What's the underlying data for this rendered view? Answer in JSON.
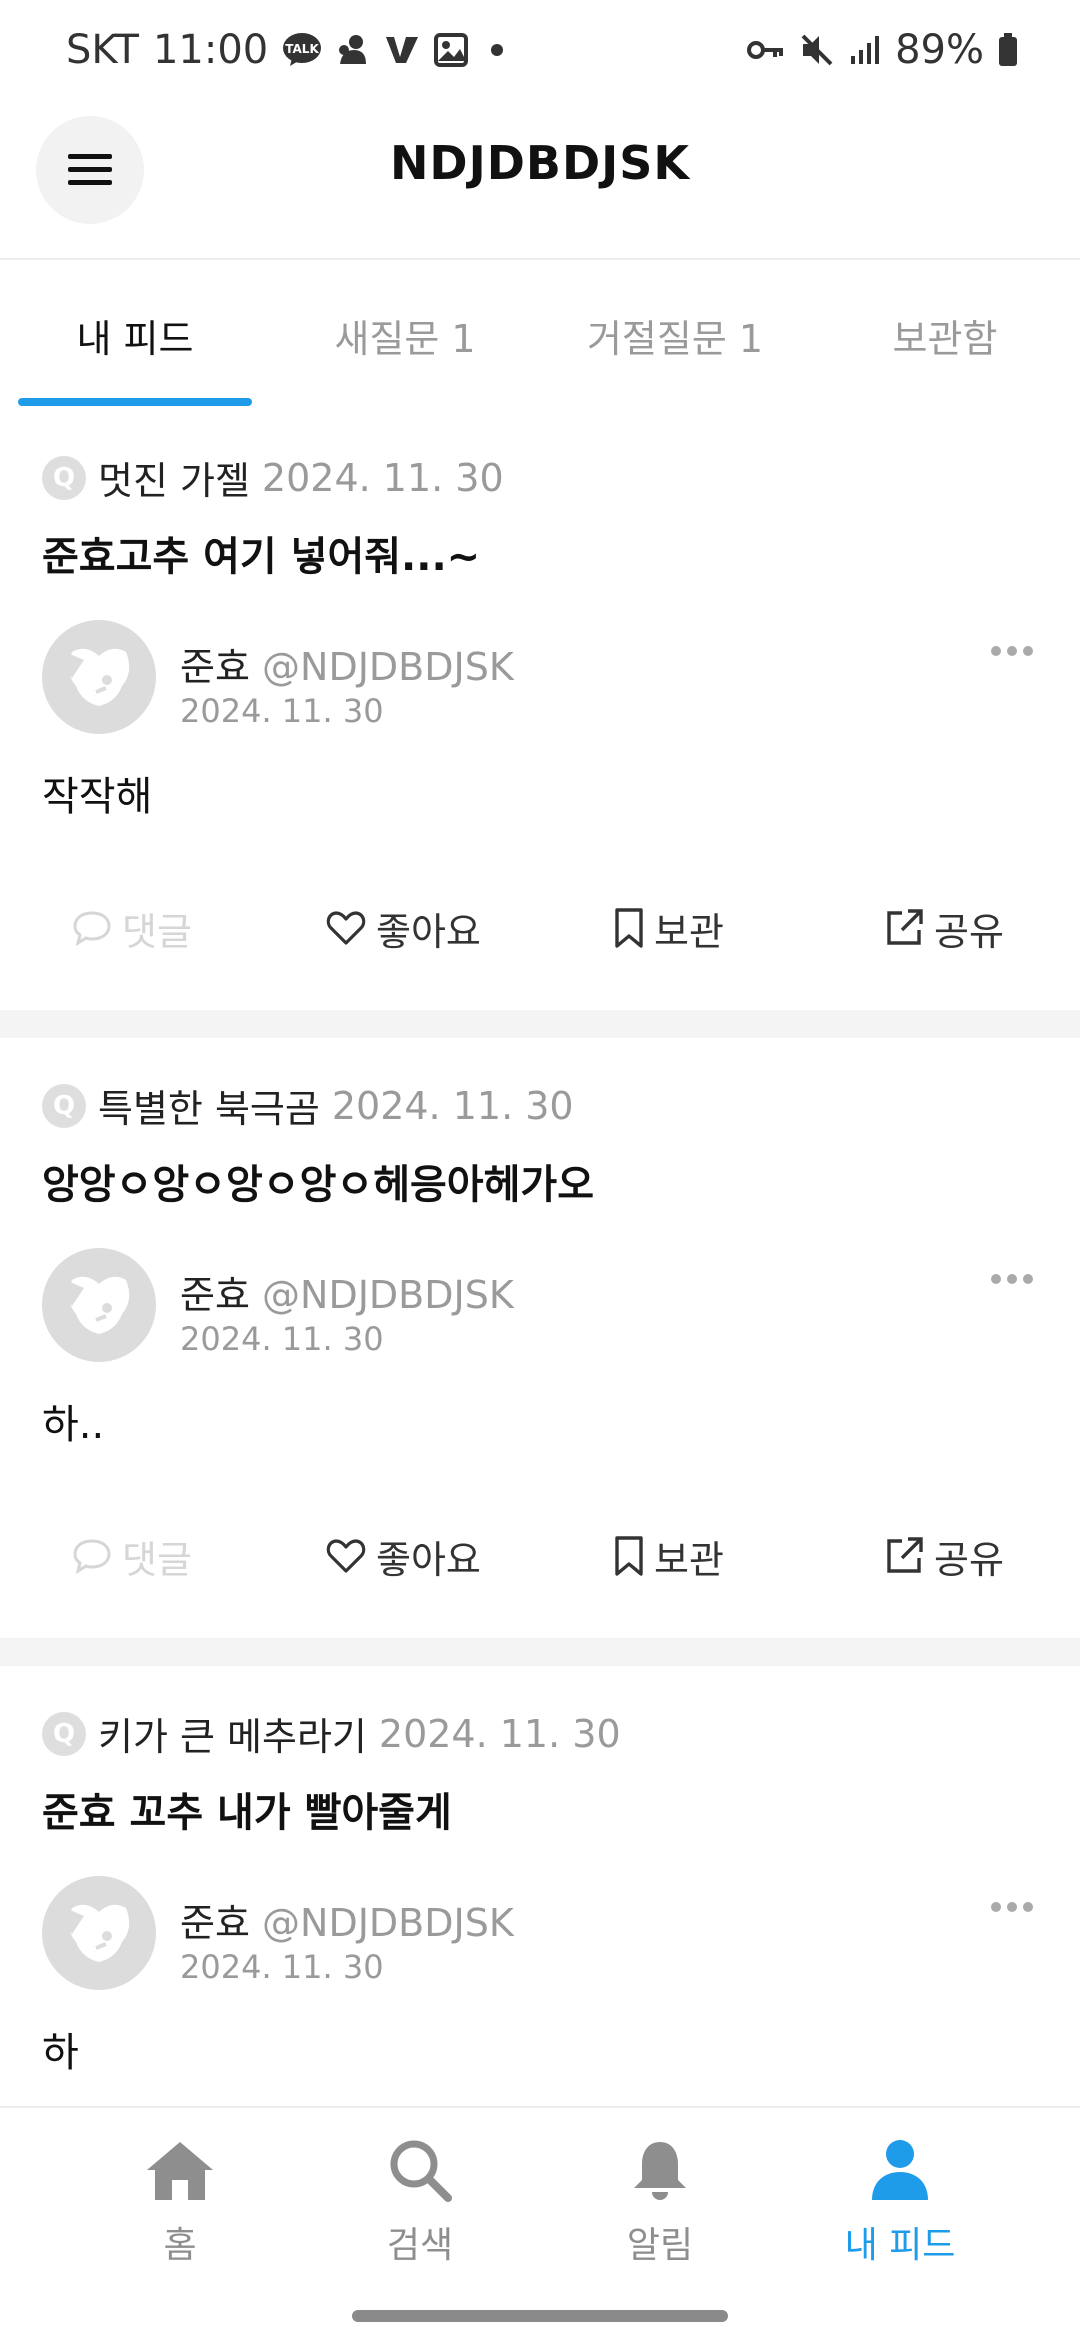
{
  "status_bar": {
    "carrier": "SKT",
    "time": "11:00",
    "battery": "89%",
    "talk_icon_label": "TALK"
  },
  "header": {
    "title": "NDJDBDJSK"
  },
  "tabs": [
    {
      "label": "내 피드",
      "active": true
    },
    {
      "label": "새질문 1",
      "active": false
    },
    {
      "label": "거절질문 1",
      "active": false
    },
    {
      "label": "보관함",
      "active": false
    }
  ],
  "feed": [
    {
      "question_badge": "Q",
      "question_author": "멋진 가젤",
      "question_date": "2024. 11. 30",
      "question_text": "준효고추 여기 넣어줘...~",
      "answer_author": "준효",
      "answer_handle": "@NDJDBDJSK",
      "answer_date": "2024. 11. 30",
      "answer_text": "작작해"
    },
    {
      "question_badge": "Q",
      "question_author": "특별한 북극곰",
      "question_date": "2024. 11. 30",
      "question_text": "앙앙ㅇ앙ㅇ앙ㅇ앙ㅇ헤응아헤가오",
      "answer_author": "준효",
      "answer_handle": "@NDJDBDJSK",
      "answer_date": "2024. 11. 30",
      "answer_text": "하.."
    },
    {
      "question_badge": "Q",
      "question_author": "키가 큰 메추라기",
      "question_date": "2024. 11. 30",
      "question_text": "준효 꼬추 내가 빨아줄게",
      "answer_author": "준효",
      "answer_handle": "@NDJDBDJSK",
      "answer_date": "2024. 11. 30",
      "answer_text": "하"
    }
  ],
  "actions": {
    "comment": "댓글",
    "like": "좋아요",
    "save": "보관",
    "share": "공유"
  },
  "bottom_nav": [
    {
      "label": "홈",
      "icon": "home-icon",
      "active": false
    },
    {
      "label": "검색",
      "icon": "search-icon",
      "active": false
    },
    {
      "label": "알림",
      "icon": "bell-icon",
      "active": false
    },
    {
      "label": "내 피드",
      "icon": "person-icon",
      "active": true
    }
  ],
  "colors": {
    "accent": "#1e9be9",
    "muted": "#9a9a9a",
    "disabled": "#d6d6d6"
  }
}
